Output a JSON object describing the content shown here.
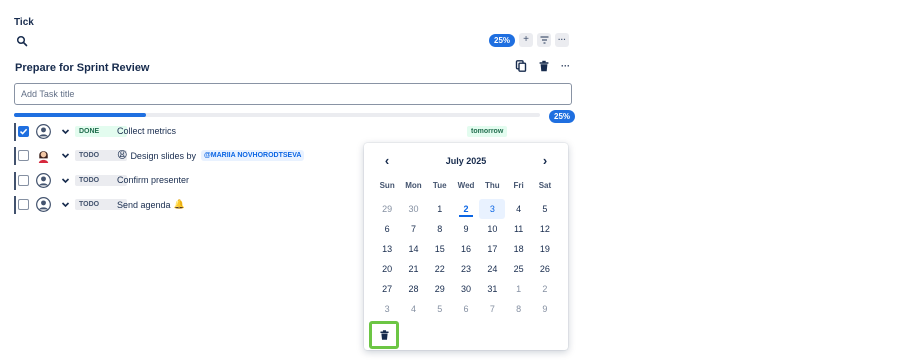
{
  "app": {
    "title": "Tick"
  },
  "toolbar": {
    "progress": "25%",
    "add_label": "+",
    "filter_icon": "filter-icon",
    "more_label": "···"
  },
  "list": {
    "title": "Prepare for Sprint Review",
    "add_placeholder": "Add Task title",
    "progress_label": "25%",
    "progress_fraction": 0.25,
    "more_label": "···"
  },
  "tasks": [
    {
      "status": "DONE",
      "title": "Collect metrics",
      "done": true,
      "due": "tomorrow"
    },
    {
      "status": "TODO",
      "prefix_emoji": "😩",
      "title": "Design slides by",
      "mention": "@MARIIA NOVHORODTSEVA",
      "done": false
    },
    {
      "status": "TODO",
      "title": "Confirm presenter",
      "done": false
    },
    {
      "status": "TODO",
      "title": "Send agenda",
      "suffix_emoji": "🔔",
      "done": false
    }
  ],
  "calendar": {
    "month": "July 2025",
    "prev": "‹",
    "next": "›",
    "weekdays": [
      "Sun",
      "Mon",
      "Tue",
      "Wed",
      "Thu",
      "Fri",
      "Sat"
    ],
    "weeks": [
      [
        "29",
        "30",
        "1",
        "2",
        "3",
        "4",
        "5"
      ],
      [
        "6",
        "7",
        "8",
        "9",
        "10",
        "11",
        "12"
      ],
      [
        "13",
        "14",
        "15",
        "16",
        "17",
        "18",
        "19"
      ],
      [
        "20",
        "21",
        "22",
        "23",
        "24",
        "25",
        "26"
      ],
      [
        "27",
        "28",
        "29",
        "30",
        "31",
        "1",
        "2"
      ],
      [
        "3",
        "4",
        "5",
        "6",
        "7",
        "8",
        "9"
      ]
    ],
    "today": "2",
    "selected": "3",
    "clear_icon": "trash-icon"
  },
  "colors": {
    "accent": "#1f6fe0",
    "done_bg": "#e3fcef",
    "done_fg": "#216e4e",
    "highlight": "#6cc644"
  }
}
